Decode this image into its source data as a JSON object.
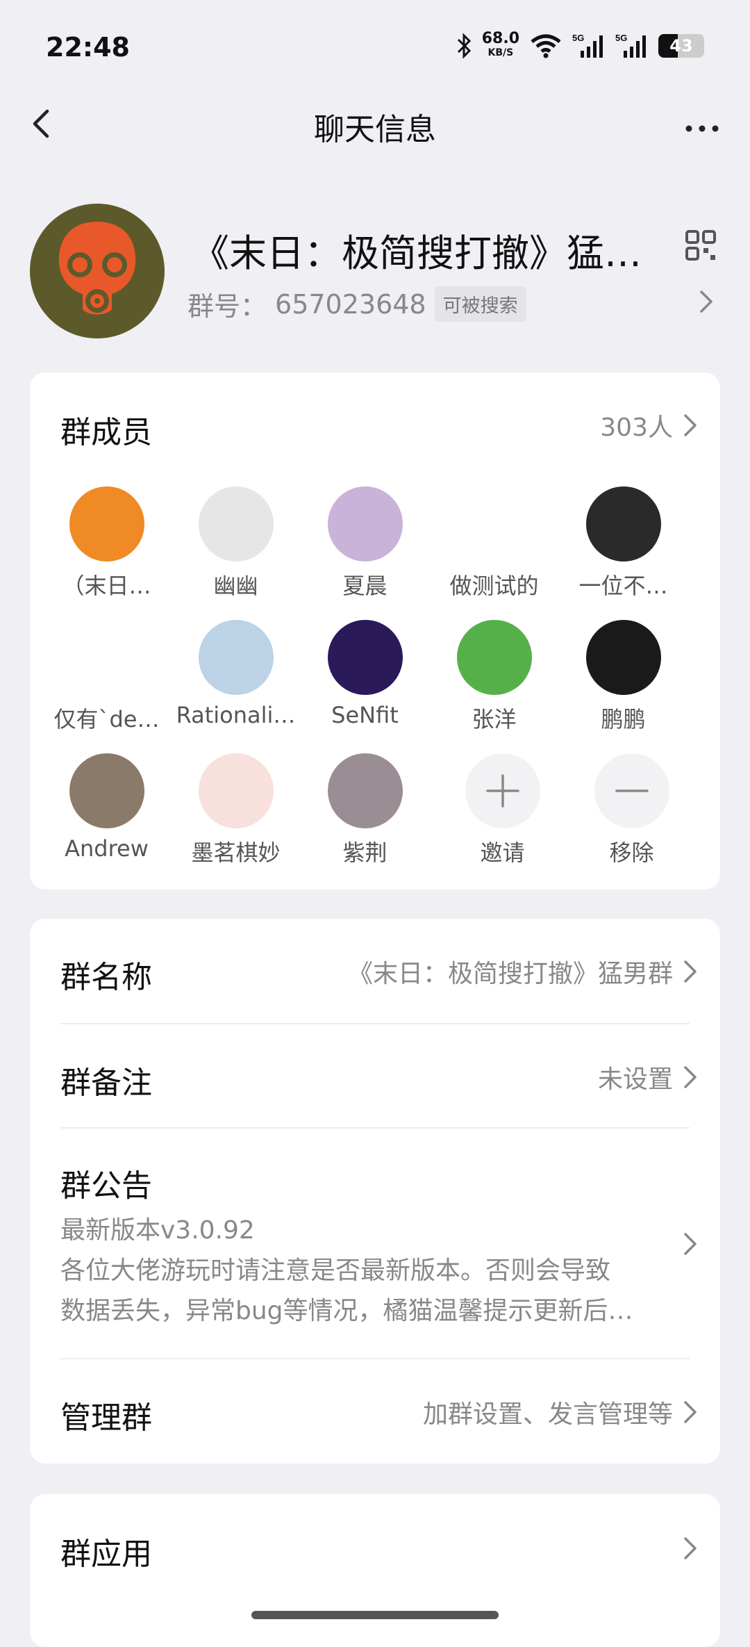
{
  "status": {
    "time": "22:48",
    "speed_value": "68.0",
    "speed_unit": "KB/S",
    "battery": "43",
    "battery_level": 0.43,
    "icons": [
      "bluetooth-icon",
      "wifi-icon",
      "signal-5g-icon",
      "signal-5g-icon"
    ]
  },
  "nav": {
    "title": "聊天信息",
    "back_icon": "chevron-left-icon",
    "more_icon": "more-icon"
  },
  "group": {
    "name": "《末日：极简搜打撤》猛男群",
    "id_label": "群号：",
    "id": "657023648",
    "searchable_badge": "可被搜索",
    "avatar_color": "#5c5a2a",
    "avatar_accent": "#e8582a"
  },
  "members": {
    "title": "群成员",
    "count": "303人",
    "items": [
      {
        "name": "（末日…",
        "color": "#f08a24"
      },
      {
        "name": "幽幽",
        "color": "#e6e6e6"
      },
      {
        "name": "夏晨",
        "color": "#c9b3d8"
      },
      {
        "name": "做测试的",
        "color": "#ffffff"
      },
      {
        "name": "一位不…",
        "color": "#2a2a2a"
      },
      {
        "name": "仅有`de…",
        "color": "#ffffff"
      },
      {
        "name": "Rationali…",
        "color": "#bcd2e6"
      },
      {
        "name": "SeNfit",
        "color": "#2a1a5a"
      },
      {
        "name": "张洋",
        "color": "#56b04a"
      },
      {
        "name": "鹏鹏",
        "color": "#1a1a1a"
      },
      {
        "name": "Andrew",
        "color": "#8a7a6a"
      },
      {
        "name": "墨茗棋妙",
        "color": "#f8e0dc"
      },
      {
        "name": "紫荆",
        "color": "#9a8e94"
      }
    ],
    "invite_label": "邀请",
    "remove_label": "移除"
  },
  "settings": {
    "group_name_label": "群名称",
    "group_name_value": "《末日：极简搜打撤》猛男群",
    "remark_label": "群备注",
    "remark_value": "未设置",
    "notice_label": "群公告",
    "notice_lines": [
      "最新版本v3.0.92",
      "各位大佬游玩时请注意是否最新版本。否则会导致",
      "数据丢失，异常bug等情况，橘猫温馨提示更新后…"
    ],
    "manage_label": "管理群",
    "manage_value": "加群设置、发言管理等"
  },
  "apps": {
    "label": "群应用"
  }
}
